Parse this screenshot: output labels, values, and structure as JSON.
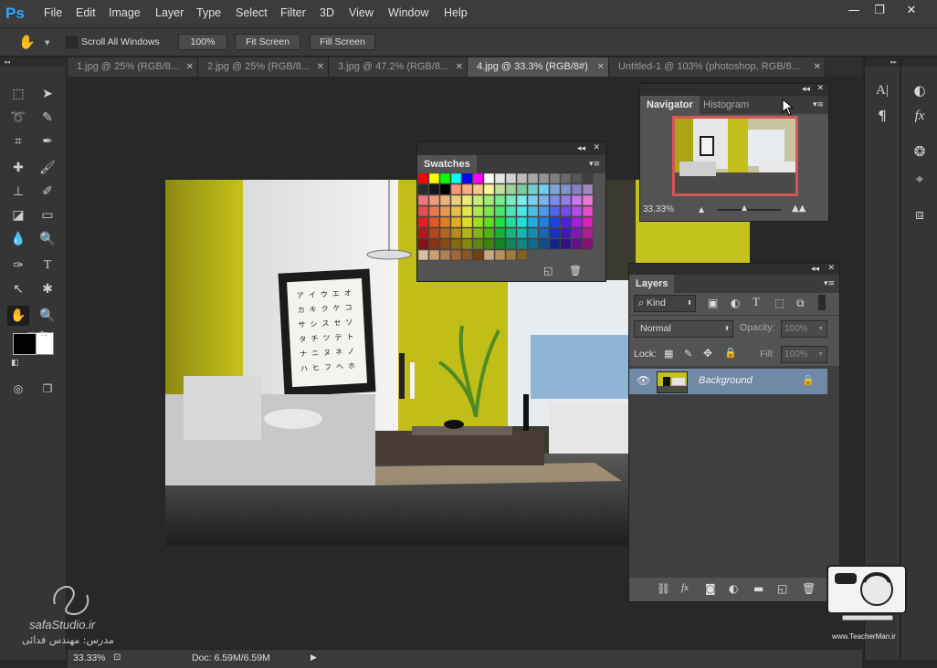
{
  "app": {
    "logo": "Ps"
  },
  "menu": {
    "items": [
      "File",
      "Edit",
      "Image",
      "Layer",
      "Type",
      "Select",
      "Filter",
      "3D",
      "View",
      "Window",
      "Help"
    ]
  },
  "window_controls": {
    "minimize": "—",
    "restore": "❐",
    "close": "✕"
  },
  "options_bar": {
    "scroll_all_label": "Scroll All Windows",
    "zoom_button": "100%",
    "fit_screen_button": "Fit Screen",
    "fill_screen_button": "Fill Screen"
  },
  "tabs": [
    {
      "label": "1.jpg @ 25% (RGB/8...",
      "active": false
    },
    {
      "label": "2.jpg @ 25% (RGB/8...",
      "active": false
    },
    {
      "label": "3.jpg @ 47.2% (RGB/8...",
      "active": false
    },
    {
      "label": "4.jpg @ 33.3% (RGB/8#)",
      "active": true
    },
    {
      "label": "Untitled-1 @ 103% (photoshop, RGB/8...",
      "active": false
    }
  ],
  "swatches": {
    "title": "Swatches"
  },
  "navigator": {
    "tab": "Navigator",
    "tab2": "Histogram",
    "zoom": "33.33%"
  },
  "layers": {
    "title": "Layers",
    "filter_kind": "Kind",
    "blend_mode": "Normal",
    "opacity_label": "Opacity:",
    "opacity_value": "100%",
    "lock_label": "Lock:",
    "fill_label": "Fill:",
    "fill_value": "100%",
    "layer_name": "Background"
  },
  "status": {
    "zoom": "33.33%",
    "doc": "Doc: 6.59M/6.59M"
  },
  "watermark": {
    "site": "safaStudio.ir",
    "teacher": "مدرس: مهندس فدائی",
    "site2": "www.TeacherMan.ir"
  },
  "frame_chars": [
    "ア",
    "イ",
    "ウ",
    "エ",
    "オ",
    "カ",
    "キ",
    "ク",
    "ケ",
    "コ",
    "サ",
    "シ",
    "ス",
    "セ",
    "ソ",
    "タ",
    "チ",
    "ツ",
    "テ",
    "ト",
    "ナ",
    "ニ",
    "ヌ",
    "ネ",
    "ノ",
    "ハ",
    "ヒ",
    "フ",
    "ヘ",
    "ホ"
  ]
}
